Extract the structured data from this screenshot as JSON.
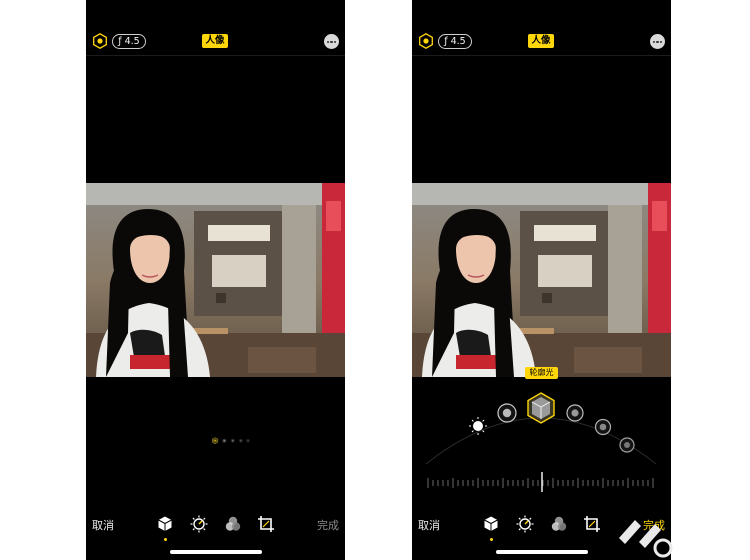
{
  "left_screen": {
    "aperture": "ƒ 4.5",
    "mode_label": "人像",
    "cancel_label": "取消",
    "done_label": "完成",
    "done_color": "#8a8a8a"
  },
  "right_screen": {
    "aperture": "ƒ 4.5",
    "mode_label": "人像",
    "selected_light_label": "轮廓光",
    "cancel_label": "取消",
    "done_label": "完成",
    "done_color": "#ffd60a"
  },
  "colors": {
    "accent": "#ffd60a",
    "background": "#000000"
  },
  "icons": {
    "top": [
      "depth-hexagon-icon",
      "more-icon"
    ],
    "toolbar": [
      "portrait-cube-icon",
      "adjust-dial-icon",
      "filters-icon",
      "crop-icon"
    ],
    "lighting": [
      "natural-light-icon",
      "studio-light-icon",
      "contour-light-icon",
      "stage-light-icon",
      "stage-light-mono-icon",
      "high-key-mono-icon"
    ]
  }
}
